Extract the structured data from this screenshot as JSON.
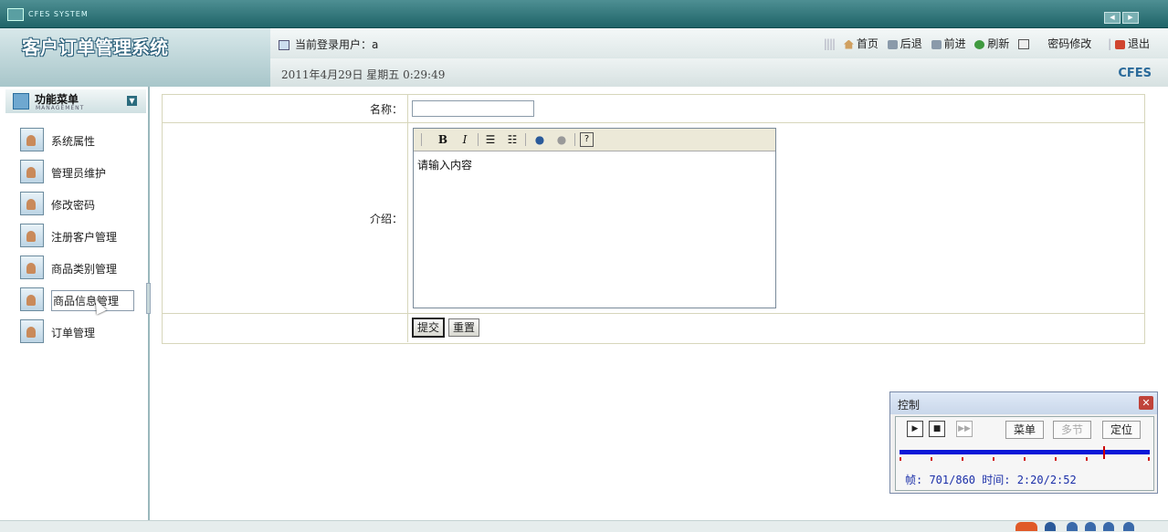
{
  "window": {
    "system_title": "CFES SYSTEM"
  },
  "header": {
    "app_title": "客户订单管理系统",
    "user_label": "当前登录用户：",
    "user_name": "a",
    "datetime": "2011年4月29日  星期五  0:29:49",
    "brand": "CFES",
    "links": [
      {
        "label": "首页",
        "icon": "home-icon"
      },
      {
        "label": "后退",
        "icon": "back-icon"
      },
      {
        "label": "前进",
        "icon": "forward-icon"
      },
      {
        "label": "刷新",
        "icon": "refresh-icon"
      },
      {
        "label": "密码修改",
        "icon": "edit-icon"
      },
      {
        "label": "退出",
        "icon": "exit-icon"
      }
    ]
  },
  "sidebar": {
    "title": "功能菜单",
    "subtitle": "MANAGEMENT",
    "items": [
      {
        "label": "系统属性"
      },
      {
        "label": "管理员维护"
      },
      {
        "label": "修改密码"
      },
      {
        "label": "注册客户管理"
      },
      {
        "label": "商品类别管理"
      },
      {
        "label": "商品信息管理",
        "selected": true
      },
      {
        "label": "订单管理"
      }
    ]
  },
  "form": {
    "name_label": "名称：",
    "name_value": "",
    "intro_label": "介绍：",
    "editor_content": "请输入内容",
    "toolbar": [
      "B",
      "I"
    ],
    "submit_label": "提交",
    "reset_label": "重置"
  },
  "control_panel": {
    "title": "控制",
    "menu_label": "菜单",
    "multi_label": "多节",
    "locate_label": "定位",
    "status": "帧: 701/860 时间: 2:20/2:52",
    "progress": 0.815
  }
}
